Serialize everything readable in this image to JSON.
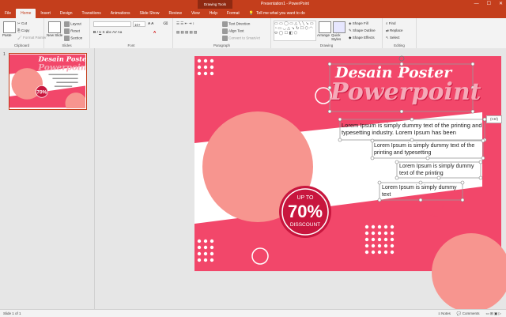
{
  "titlebar": {
    "contextual": "Drawing Tools",
    "title": "Presentation1 - PowerPoint"
  },
  "tabs": [
    "File",
    "Home",
    "Insert",
    "Design",
    "Transitions",
    "Animations",
    "Slide Show",
    "Review",
    "View",
    "Help",
    "Format"
  ],
  "tell_me": "Tell me what you want to do",
  "ribbon": {
    "clipboard": {
      "label": "Clipboard",
      "paste": "Paste",
      "cut": "Cut",
      "copy": "Copy",
      "format_painter": "Format Painter"
    },
    "slides": {
      "label": "Slides",
      "new_slide": "New Slide",
      "layout": "Layout",
      "reset": "Reset",
      "section": "Section"
    },
    "font": {
      "label": "Font",
      "size": "10+"
    },
    "paragraph": {
      "label": "Paragraph",
      "text_direction": "Text Direction",
      "align_text": "Align Text",
      "smartart": "Convert to SmartArt"
    },
    "drawing": {
      "label": "Drawing",
      "arrange": "Arrange",
      "quick_styles": "Quick Styles",
      "shape_fill": "Shape Fill",
      "shape_outline": "Shape Outline",
      "shape_effects": "Shape Effects"
    },
    "editing": {
      "label": "Editing",
      "find": "Find",
      "replace": "Replace",
      "select": "Select"
    }
  },
  "thumbnail": {
    "number": "1"
  },
  "slide": {
    "title1": "Desain Poster",
    "title2": "Powerpoint",
    "text1": "Lorem Ipsum is simply dummy text of the printing and typesetting industry. Lorem Ipsum has been",
    "text2": "Lorem Ipsum is simply dummy text of the printing and typesetting",
    "text3": "Lorem Ipsum is simply dummy text of the printing",
    "text4": "Lorem Ipsum is simply dummy text",
    "badge_top": "UP TO",
    "badge_percent": "70%",
    "badge_bottom": "DISSCOUNT",
    "paste_tag": "(Ctrl)"
  },
  "status": {
    "slide_info": "Slide 1 of 1",
    "notes": "Notes",
    "comments": "Comments"
  },
  "colors": {
    "accent": "#c43e1c",
    "slide_pink": "#f2476a",
    "salmon": "#f7958f",
    "title_pink": "#f5a9b8"
  }
}
